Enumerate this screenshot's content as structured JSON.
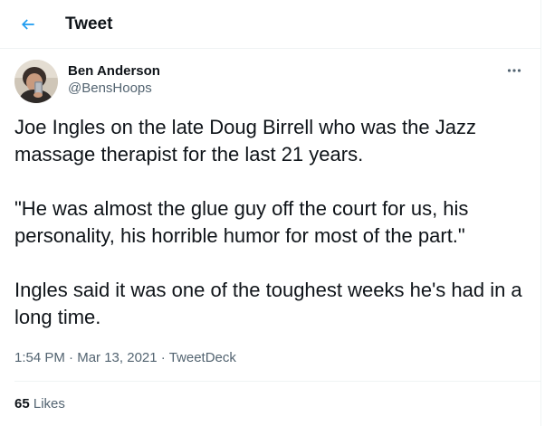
{
  "header": {
    "back_icon": "arrow-left-icon",
    "title": "Tweet",
    "accent_color": "#1d9bf0"
  },
  "author": {
    "display_name": "Ben Anderson",
    "handle": "@BensHoops",
    "avatar_alt": "Ben Anderson",
    "more_icon": "more-horizontal-icon"
  },
  "tweet": {
    "paragraphs": [
      "Joe Ingles on the late Doug Birrell who was the Jazz massage therapist for the last 21 years.",
      "\"He was almost the glue guy off the court for us, his personality, his horrible humor for most of the part.\"",
      "Ingles said it was one of the toughest weeks he's had in a long time."
    ],
    "time": "1:54 PM",
    "separator": "·",
    "date": "Mar 13, 2021",
    "source": "TweetDeck"
  },
  "stats": {
    "likes_count": "65",
    "likes_label": "Likes"
  }
}
